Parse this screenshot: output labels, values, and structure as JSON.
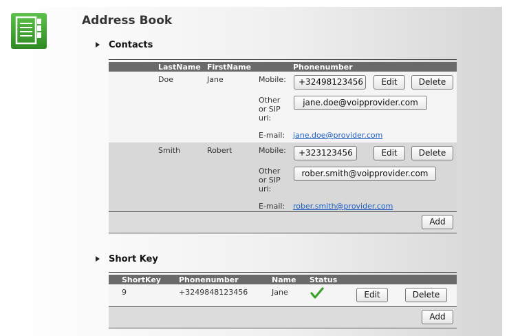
{
  "page": {
    "title": "Address Book"
  },
  "contacts": {
    "section_title": "Contacts",
    "columns": {
      "lastname": "LastName",
      "firstname": "FirstName",
      "phone": "Phonenumber"
    },
    "labels": {
      "mobile": "Mobile:",
      "other_1": "Other",
      "other_2": "or SIP",
      "other_3": "uri:",
      "email": "E-mail:"
    },
    "rows": [
      {
        "last": "Doe",
        "first": "Jane",
        "mobile": "+32498123456",
        "other": "jane.doe@voipprovider.com",
        "email": "jane.doe@provider.com"
      },
      {
        "last": "Smith",
        "first": "Robert",
        "mobile": "+323123456",
        "other": "rober.smith@voipprovider.com",
        "email": "rober.smith@provider.com"
      }
    ],
    "edit_label": "Edit",
    "delete_label": "Delete",
    "add_label": "Add"
  },
  "shortkeys": {
    "section_title": "Short Key",
    "columns": {
      "shortkey": "ShortKey",
      "phone": "Phonenumber",
      "name": "Name",
      "status": "Status"
    },
    "rows": [
      {
        "key": "9",
        "phone": "+3249848123456",
        "name": "Jane",
        "status_icon": "checkmark-icon"
      }
    ],
    "edit_label": "Edit",
    "delete_label": "Delete",
    "add_label": "Add"
  },
  "colors": {
    "header_bg": "#6a6a6a",
    "link": "#1e5fc2",
    "check": "#3aa32a",
    "icon_green": "#3a9a2a"
  }
}
